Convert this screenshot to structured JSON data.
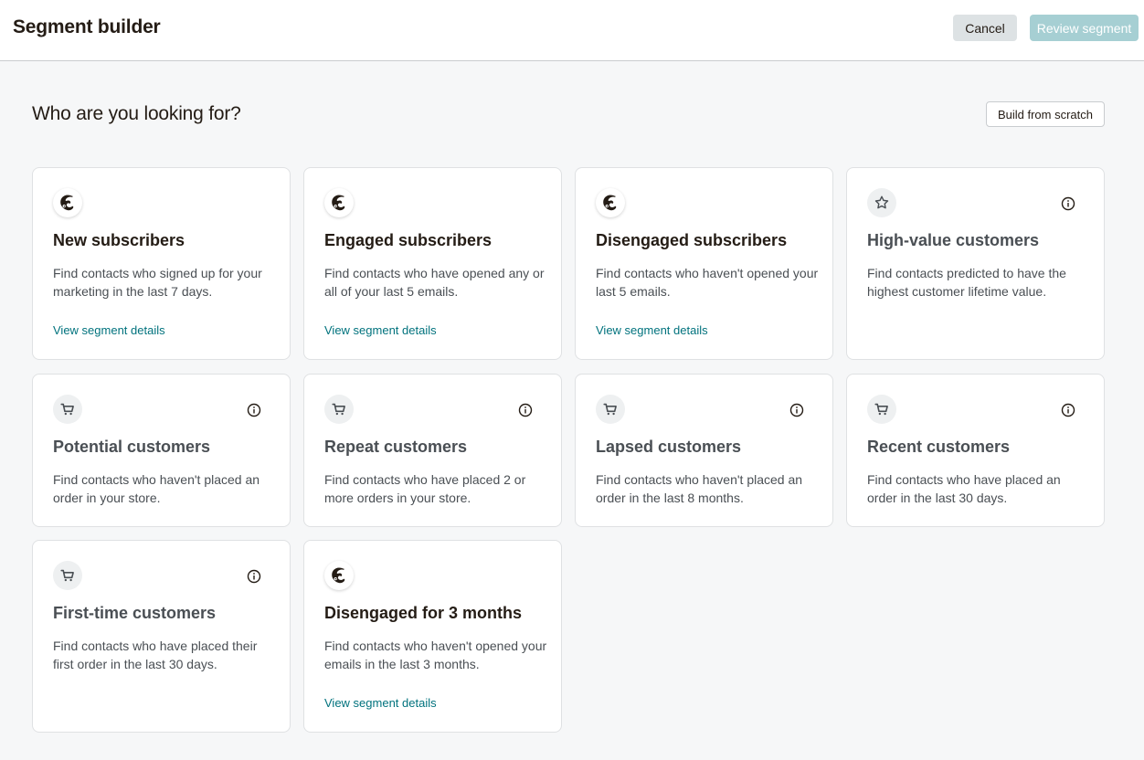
{
  "header": {
    "title": "Segment builder",
    "cancel_label": "Cancel",
    "review_label": "Review segment"
  },
  "main": {
    "heading": "Who are you looking for?",
    "build_from_scratch_label": "Build from scratch",
    "cards": [
      {
        "title": "New subscribers",
        "description": "Find contacts who signed up for your marketing in the last 7 days.",
        "link": "View segment details",
        "icon": "freddie-icon"
      },
      {
        "title": "Engaged subscribers",
        "description": "Find contacts who have opened any or all of your last 5 emails.",
        "link": "View segment details",
        "icon": "freddie-icon"
      },
      {
        "title": "Disengaged subscribers",
        "description": "Find contacts who haven't opened your last 5 emails.",
        "link": "View segment details",
        "icon": "freddie-icon"
      },
      {
        "title": "High-value customers",
        "description": "Find contacts predicted to have the highest customer lifetime value.",
        "icon": "star-badge-icon"
      },
      {
        "title": "Potential customers",
        "description": "Find contacts who haven't placed an order in your store.",
        "icon": "cart-icon"
      },
      {
        "title": "Repeat customers",
        "description": "Find contacts who have placed 2 or more orders in your store.",
        "icon": "cart-icon"
      },
      {
        "title": "Lapsed customers",
        "description": "Find contacts who haven't placed an order in the last 8 months.",
        "icon": "cart-icon"
      },
      {
        "title": "Recent customers",
        "description": "Find contacts who have placed an order in the last 30 days.",
        "icon": "cart-icon"
      },
      {
        "title": "First-time customers",
        "description": "Find contacts who have placed their first order in the last 30 days.",
        "icon": "cart-icon"
      },
      {
        "title": "Disengaged for 3 months",
        "description": "Find contacts who haven't opened your emails in the last 3 months.",
        "link": "View segment details",
        "icon": "freddie-icon"
      }
    ]
  },
  "colors": {
    "link": "#00727d",
    "review_button": "#a6cfd3",
    "cancel_button": "#dde2e4",
    "page_background": "#f6f7f8"
  }
}
